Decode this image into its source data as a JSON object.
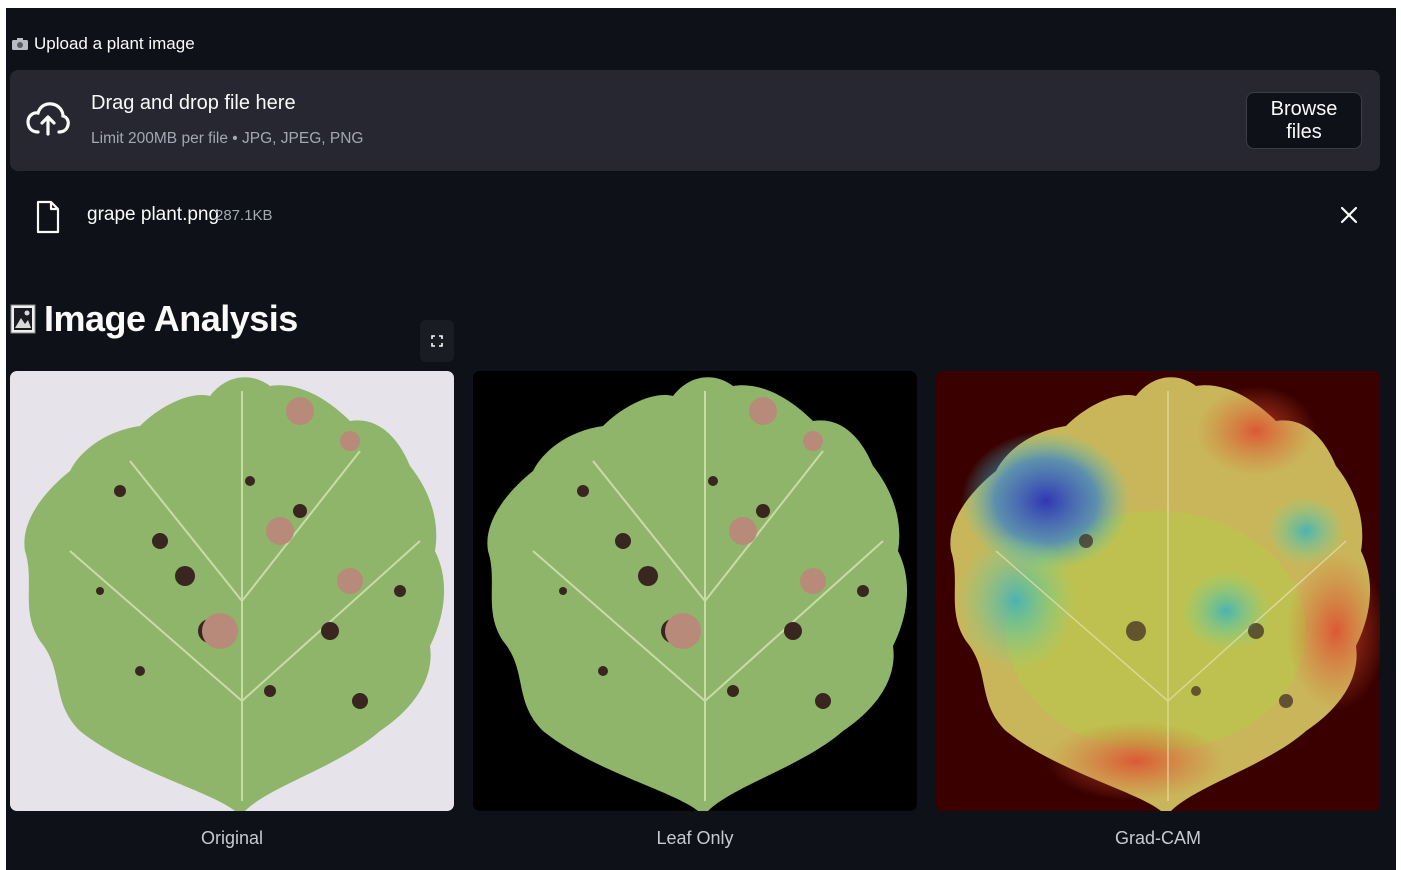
{
  "uploader": {
    "label": "Upload a plant image",
    "label_icon": "camera-icon",
    "dropzone_title": "Drag and drop file here",
    "dropzone_subtitle": "Limit 200MB per file • JPG, JPEG, PNG",
    "browse_label": "Browse files"
  },
  "uploaded_file": {
    "name": "grape plant.png",
    "size": "287.1KB"
  },
  "analysis": {
    "title": "Image Analysis",
    "title_icon": "framed-picture-icon",
    "images": [
      {
        "caption": "Original"
      },
      {
        "caption": "Leaf Only"
      },
      {
        "caption": "Grad-CAM"
      }
    ]
  },
  "colors": {
    "background": "#0e1117",
    "dropzone": "#262730",
    "text": "#fafafa",
    "muted_text": "#a3a8b4"
  }
}
